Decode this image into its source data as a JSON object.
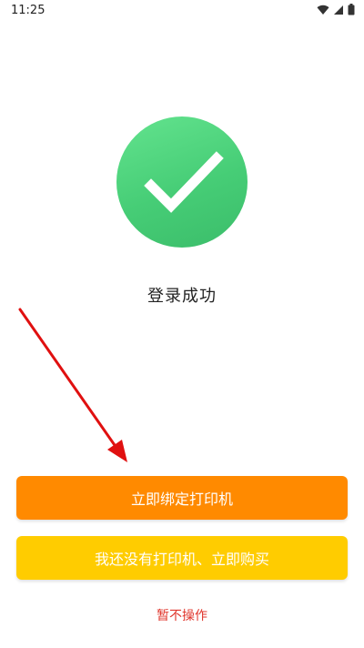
{
  "status_bar": {
    "time": "11:25",
    "icons": [
      "wifi-icon",
      "signal-icon",
      "battery-icon"
    ]
  },
  "success": {
    "icon": "checkmark-icon",
    "title": "登录成功"
  },
  "actions": {
    "bind_printer_label": "立即绑定打印机",
    "buy_printer_label": "我还没有打印机、立即购买",
    "skip_label": "暂不操作"
  },
  "colors": {
    "primary": "#ff8a00",
    "secondary": "#ffcc00",
    "success": "#46cd76",
    "skip_text": "#e0362c",
    "annotation": "#e01010"
  }
}
